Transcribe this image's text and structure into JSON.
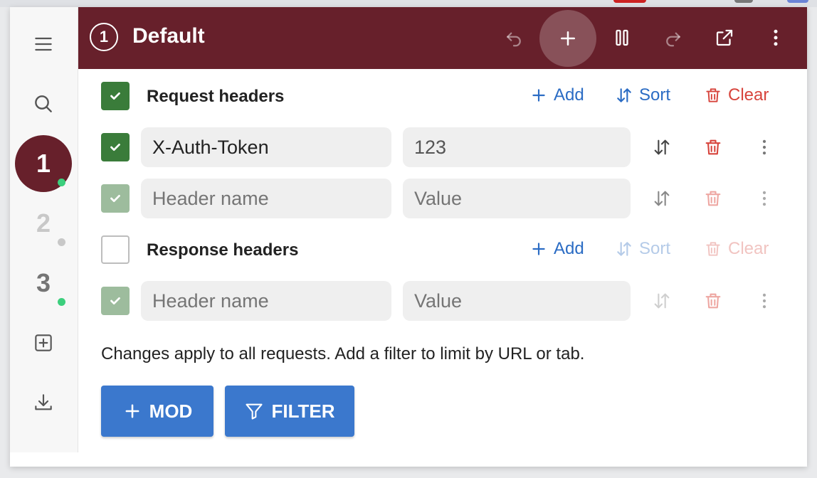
{
  "colors": {
    "header_bg": "#67202b",
    "accent_blue": "#2b6cc4",
    "danger_red": "#d7443c",
    "check_green": "#3a7c3a",
    "button_blue": "#3b78cd",
    "status_green": "#3ccf7d"
  },
  "sidebar": {
    "menu_icon": "hamburger-icon",
    "search_icon": "search-icon",
    "profiles": [
      {
        "label": "1",
        "active": true,
        "status": "green"
      },
      {
        "label": "2",
        "active": false,
        "status": "gray"
      },
      {
        "label": "3",
        "active": false,
        "status": "green"
      }
    ],
    "add_profile_icon": "plus-square-icon",
    "download_icon": "download-icon"
  },
  "header": {
    "profile_number": "1",
    "profile_name": "Default",
    "icons": [
      "undo-icon",
      "plus-icon",
      "pause-icon",
      "redo-icon",
      "open-external-icon",
      "more-vert-icon"
    ]
  },
  "request_section": {
    "title": "Request headers",
    "enabled": true,
    "add_label": "Add",
    "sort_label": "Sort",
    "clear_label": "Clear",
    "rows": [
      {
        "name": "X-Auth-Token",
        "value": "123",
        "enabled": true
      },
      {
        "name": "",
        "value": "",
        "name_placeholder": "Header name",
        "value_placeholder": "Value",
        "enabled": true
      }
    ]
  },
  "response_section": {
    "title": "Response headers",
    "enabled": false,
    "add_label": "Add",
    "sort_label": "Sort",
    "clear_label": "Clear",
    "rows": [
      {
        "name": "",
        "value": "",
        "name_placeholder": "Header name",
        "value_placeholder": "Value",
        "enabled": true
      }
    ]
  },
  "note": "Changes apply to all requests. Add a filter to limit by URL or tab.",
  "buttons": {
    "mod_label": "MOD",
    "filter_label": "FILTER"
  }
}
